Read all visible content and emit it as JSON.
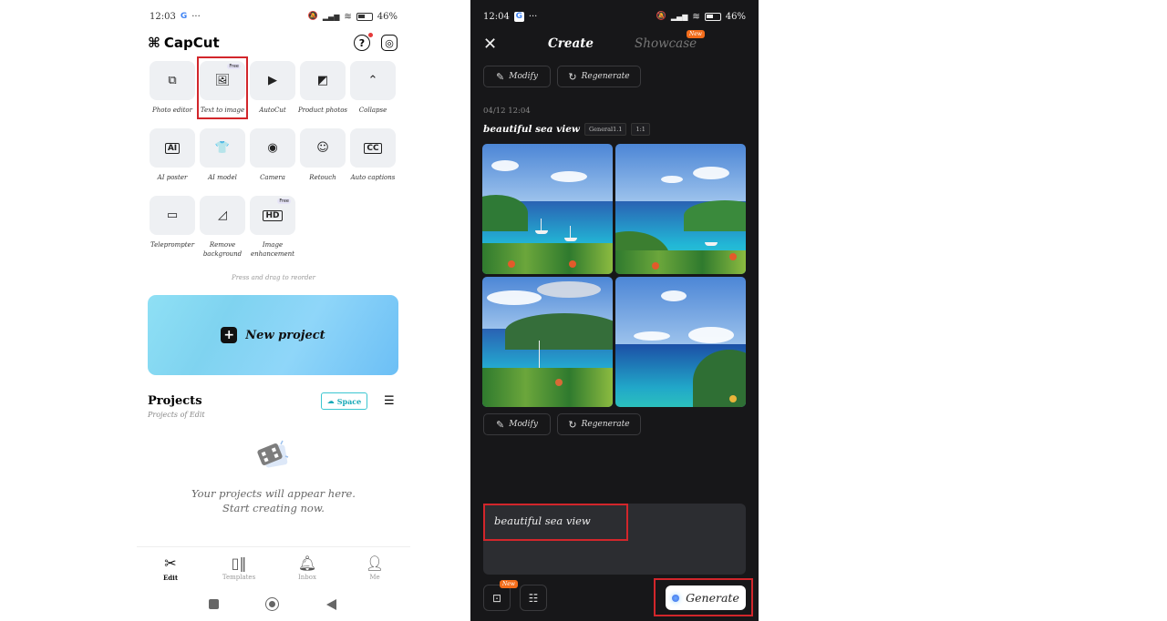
{
  "left_screen": {
    "status": {
      "time": "12:03",
      "battery": "46%"
    },
    "app_name": "CapCut",
    "tools": [
      {
        "label": "Photo editor",
        "icon": "photo-editor-icon",
        "glyph": "⧉"
      },
      {
        "label": "Text to image",
        "icon": "text-to-image-icon",
        "glyph": "🖼",
        "badge": "Free",
        "highlighted": true
      },
      {
        "label": "AutoCut",
        "icon": "autocut-icon",
        "glyph": "▶"
      },
      {
        "label": "Product photos",
        "icon": "product-photos-icon",
        "glyph": "◩"
      },
      {
        "label": "Collapse",
        "icon": "chevron-up-icon",
        "glyph": "⌃"
      },
      {
        "label": "AI poster",
        "icon": "ai-poster-icon",
        "glyph": "AI"
      },
      {
        "label": "AI model",
        "icon": "ai-model-icon",
        "glyph": "👕"
      },
      {
        "label": "Camera",
        "icon": "camera-icon",
        "glyph": "◉"
      },
      {
        "label": "Retouch",
        "icon": "retouch-icon",
        "glyph": "☺"
      },
      {
        "label": "Auto captions",
        "icon": "auto-captions-icon",
        "glyph": "CC"
      },
      {
        "label": "Teleprompter",
        "icon": "teleprompter-icon",
        "glyph": "▭"
      },
      {
        "label": "Remove background",
        "label_line1": "Remove",
        "label_line2": "background",
        "icon": "remove-background-icon",
        "glyph": "◿"
      },
      {
        "label": "Image enhancement",
        "label_line1": "Image",
        "label_line2": "enhancement",
        "icon": "image-enhancement-icon",
        "glyph": "HD",
        "badge": "Free"
      }
    ],
    "reorder_hint": "Press and drag to reorder",
    "new_project_label": "New project",
    "projects": {
      "title": "Projects",
      "subtitle": "Projects of Edit",
      "space_label": "Space",
      "empty_line1": "Your projects will appear here.",
      "empty_line2": "Start creating now."
    },
    "tabbar": [
      {
        "label": "Edit",
        "active": true
      },
      {
        "label": "Templates",
        "active": false
      },
      {
        "label": "Inbox",
        "active": false
      },
      {
        "label": "Me",
        "active": false
      }
    ]
  },
  "right_screen": {
    "status": {
      "time": "12:04",
      "battery": "46%"
    },
    "tabs": [
      {
        "label": "Create",
        "active": true
      },
      {
        "label": "Showcase",
        "active": false,
        "badge": "New"
      }
    ],
    "actions": {
      "modify": "Modify",
      "regenerate": "Regenerate"
    },
    "result": {
      "date": "04/12 12:04",
      "prompt": "beautiful sea view",
      "model_tag": "General1.1",
      "ratio_tag": "1:1",
      "images": [
        "sea-view-1",
        "sea-view-2",
        "sea-view-3",
        "sea-view-4"
      ]
    },
    "input": {
      "value": "beautiful sea view"
    },
    "image_ref_badge": "New",
    "generate_label": "Generate",
    "accent_color": "#f36c1a"
  }
}
